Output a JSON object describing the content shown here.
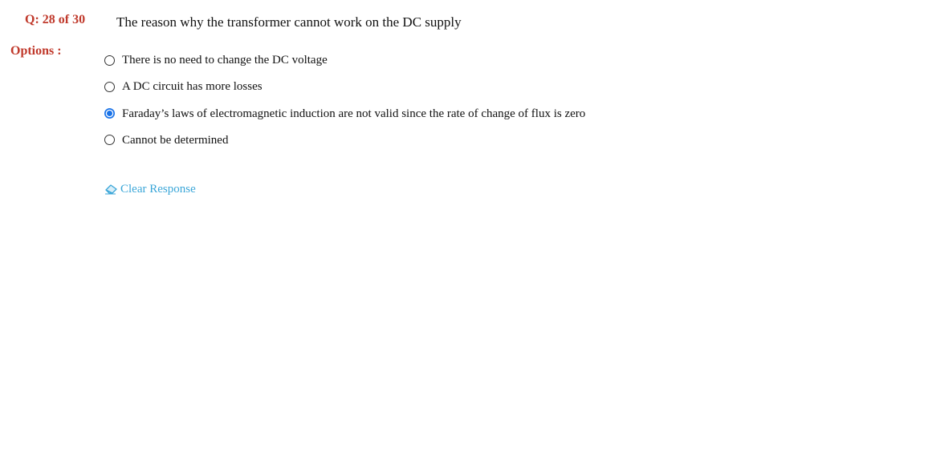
{
  "question": {
    "counter": "Q: 28 of 30",
    "text": "The reason why the transformer cannot work on the DC supply"
  },
  "options_label": "Options :",
  "options": [
    {
      "label": "There is no need to change the DC voltage",
      "selected": false
    },
    {
      "label": "A DC circuit has more losses",
      "selected": false
    },
    {
      "label": "Faraday’s laws of electromagnetic induction are not valid since the rate of change of flux is zero",
      "selected": true
    },
    {
      "label": "Cannot be determined",
      "selected": false
    }
  ],
  "clear_response": {
    "label": "Clear Response",
    "icon": "eraser-icon"
  },
  "colors": {
    "accent_red": "#c0392b",
    "radio_selected": "#1a73e8",
    "link": "#3aa6d8"
  }
}
